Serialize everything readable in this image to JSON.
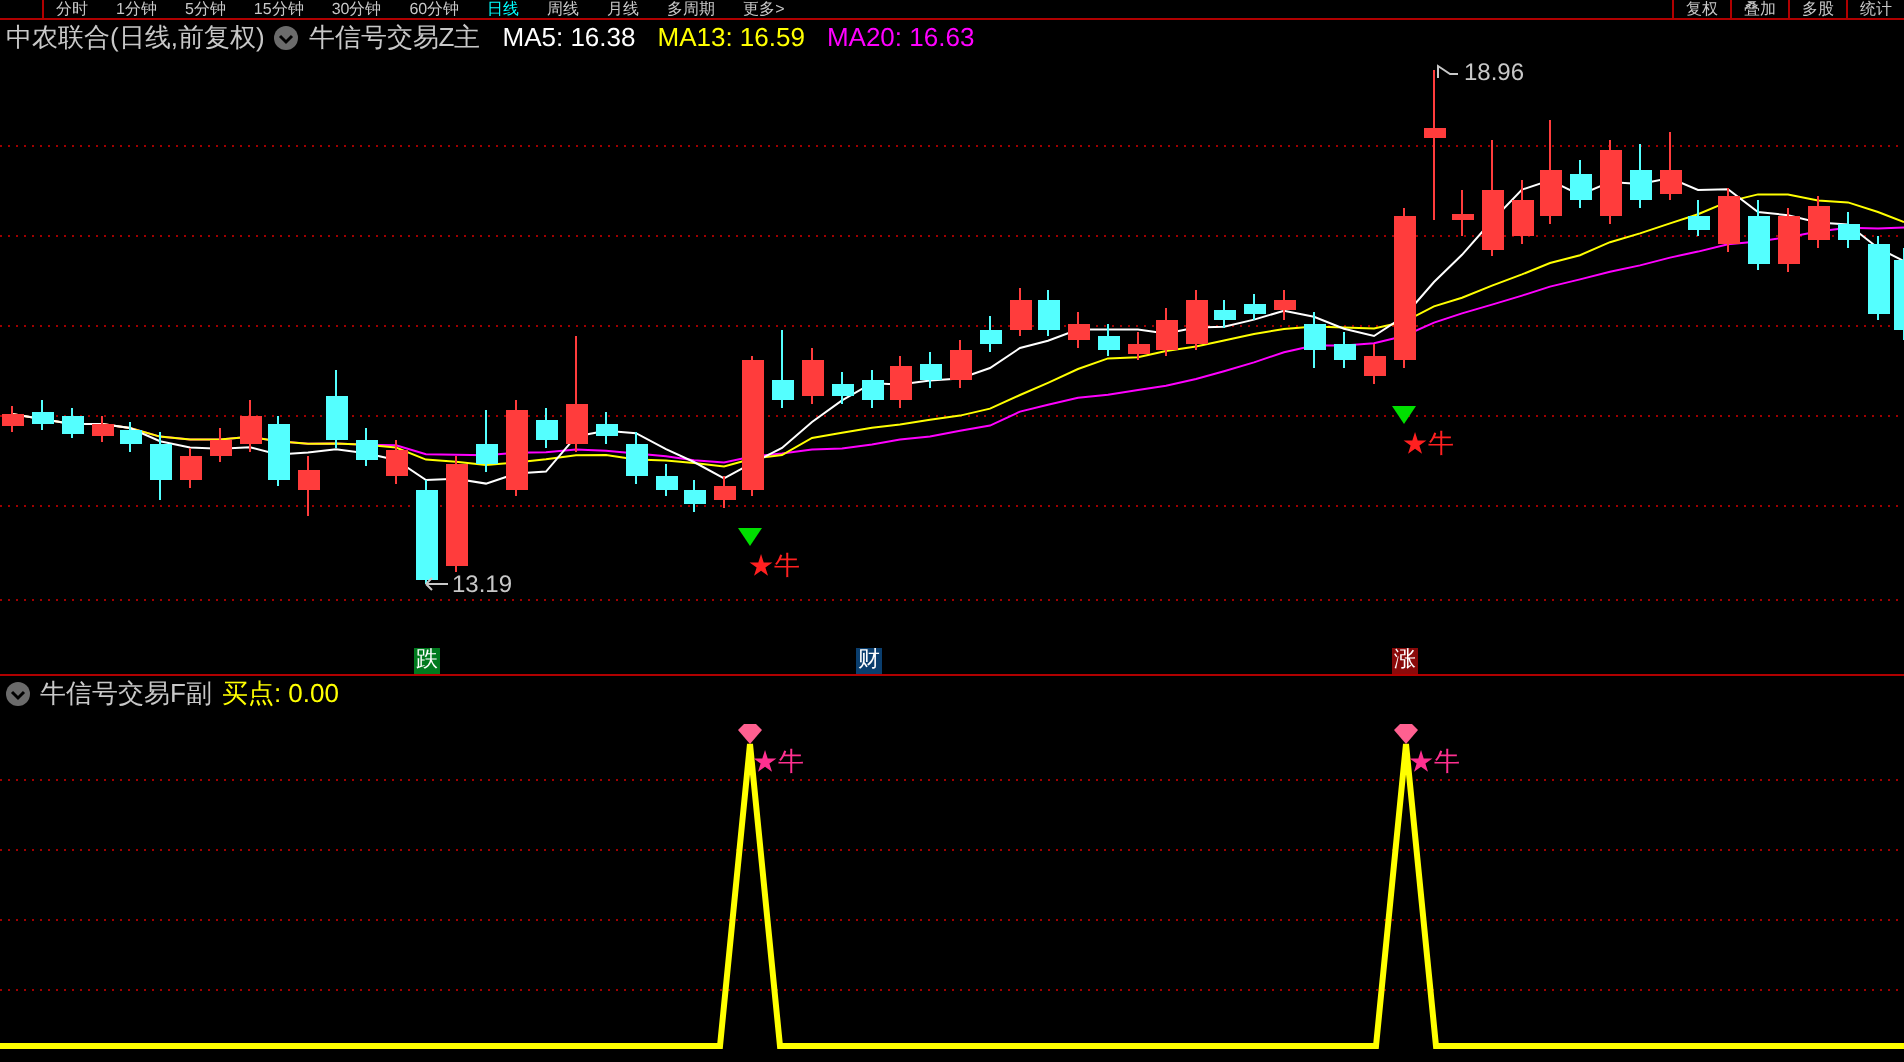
{
  "toolbar": {
    "periods": [
      {
        "label": "分时",
        "selected": false
      },
      {
        "label": "1分钟",
        "selected": false
      },
      {
        "label": "5分钟",
        "selected": false
      },
      {
        "label": "15分钟",
        "selected": false
      },
      {
        "label": "30分钟",
        "selected": false
      },
      {
        "label": "60分钟",
        "selected": false
      },
      {
        "label": "日线",
        "selected": true
      },
      {
        "label": "周线",
        "selected": false
      },
      {
        "label": "月线",
        "selected": false
      },
      {
        "label": "多周期",
        "selected": false
      },
      {
        "label": "更多>",
        "selected": false
      }
    ],
    "buttons": [
      "复权",
      "叠加",
      "多股",
      "统计"
    ]
  },
  "main_chart": {
    "stock": "中农联合(日线,前复权)",
    "indicator": "牛信号交易Z主",
    "ma": [
      {
        "label": "MA5: 16.38",
        "color": "#ffffff"
      },
      {
        "label": "MA13: 16.59",
        "color": "#ffff00"
      },
      {
        "label": "MA20: 16.63",
        "color": "#ff00ff"
      }
    ],
    "high_label": "18.96",
    "low_label": "13.19",
    "signals": [
      {
        "label": "★牛"
      },
      {
        "label": "★牛"
      }
    ],
    "markers": [
      {
        "label": "跌",
        "color": "#007a1e"
      },
      {
        "label": "财",
        "color": "#0a3e6e"
      },
      {
        "label": "涨",
        "color": "#8a0a0a"
      }
    ]
  },
  "sub_chart": {
    "indicator": "牛信号交易F副",
    "value": "买点: 0.00",
    "signals": [
      {
        "label": "★牛"
      },
      {
        "label": "★牛"
      }
    ]
  }
}
